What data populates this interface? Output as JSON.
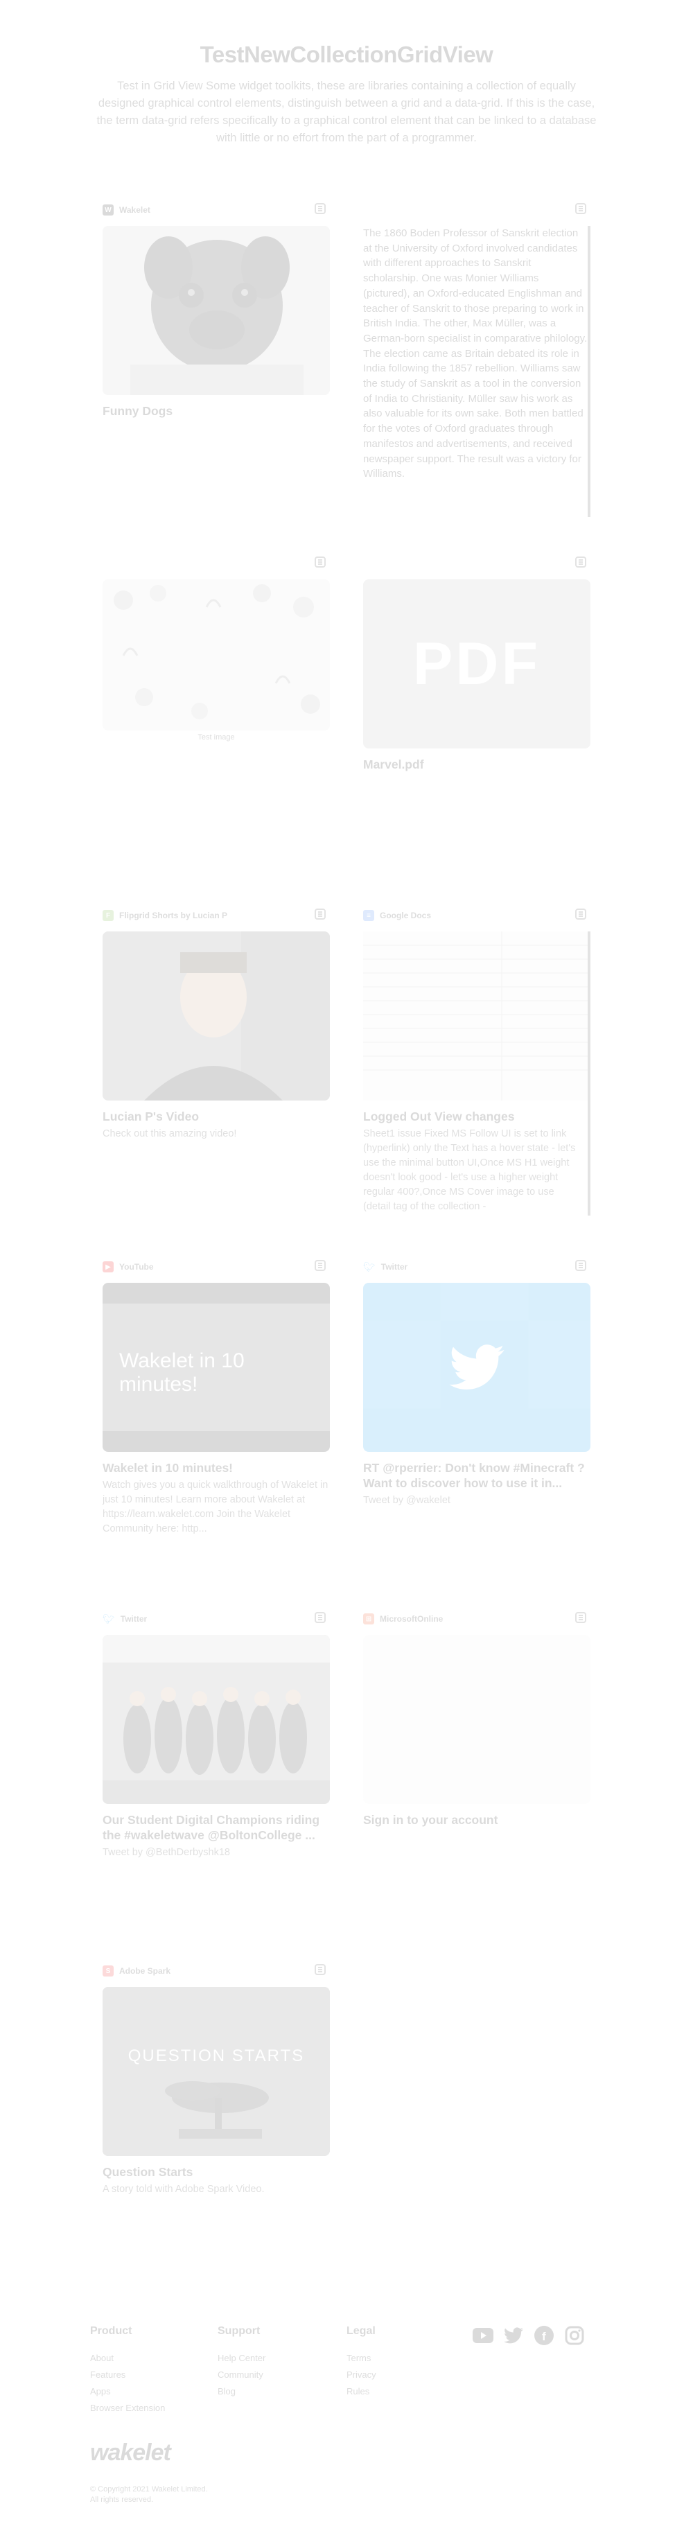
{
  "page": {
    "title": "TestNewCollectionGridView",
    "description": "Test in Grid View Some widget toolkits, these are libraries containing a collection of equally designed graphical control elements, distinguish between a grid and a data-grid. If this is the case, the term data-grid refers specifically to a graphical control element that can be linked to a database with little or no effort from the part of a programmer."
  },
  "cards": {
    "c1": {
      "source": "Wakelet",
      "title": "Funny Dogs"
    },
    "c2": {
      "text": "The 1860 Boden Professor of Sanskrit election at the University of Oxford involved candidates with different approaches to Sanskrit scholarship. One was Monier Williams (pictured), an Oxford-educated Englishman and teacher of Sanskrit to those preparing to work in British India. The other, Max Müller, was a German-born specialist in comparative philology. The election came as Britain debated its role in India following the 1857 rebellion. Williams saw the study of Sanskrit as a tool in the conversion of India to Christianity. Müller saw his work as also valuable for its own sake. Both men battled for the votes of Oxford graduates through manifestos and advertisements, and received newspaper support. The result was a victory for Williams."
    },
    "c3": {
      "caption": "Test image"
    },
    "c4": {
      "pdf_label": "PDF",
      "title": "Marvel.pdf"
    },
    "c5": {
      "source": "Flipgrid Shorts by Lucian P",
      "title": "Lucian P's Video",
      "desc": "Check out this amazing video!"
    },
    "c6": {
      "source": "Google Docs",
      "title": "Logged Out View changes",
      "desc": "Sheet1 issue Fixed MS Follow UI is set to link (hyperlink) only the Text has a hover state - let's use the minimal button UI,Once MS H1 weight doesn't look good - let's use a higher weight regular 400?,Once MS Cover image to use (detail tag of the collection -"
    },
    "c7": {
      "source": "YouTube",
      "overlay": "Wakelet in 10 minutes!",
      "title": "Wakelet in 10 minutes!",
      "desc": "Watch gives you a quick walkthrough of Wakelet in just 10 minutes! Learn more about Wakelet at https://learn.wakelet.com Join the Wakelet Community here: http..."
    },
    "c8": {
      "source": "Twitter",
      "title": "RT @rperrier: Don't know #Minecraft ? Want to discover how to use it in...",
      "desc": "Tweet by @wakelet"
    },
    "c9": {
      "source": "Twitter",
      "title": "Our Student Digital Champions riding the #wakeletwave @BoltonCollege ...",
      "desc": "Tweet by @BethDerbyshk18"
    },
    "c10": {
      "source": "MicrosoftOnline",
      "title": "Sign in to your account"
    },
    "c11": {
      "source": "Adobe Spark",
      "overlay": "QUESTION STARTS",
      "title": "Question Starts",
      "desc": "A story told with Adobe Spark Video."
    }
  },
  "footer": {
    "product": {
      "heading": "Product",
      "links": [
        "About",
        "Features",
        "Apps",
        "Browser Extension"
      ]
    },
    "support": {
      "heading": "Support",
      "links": [
        "Help Center",
        "Community",
        "Blog"
      ]
    },
    "legal": {
      "heading": "Legal",
      "links": [
        "Terms",
        "Privacy",
        "Rules"
      ]
    },
    "social_icons": [
      "youtube-icon",
      "twitter-icon",
      "facebook-icon",
      "instagram-icon"
    ],
    "logo": "wakelet",
    "copyright_1": "© Copyright 2021 Wakelet Limited.",
    "copyright_2": "All rights reserved."
  }
}
